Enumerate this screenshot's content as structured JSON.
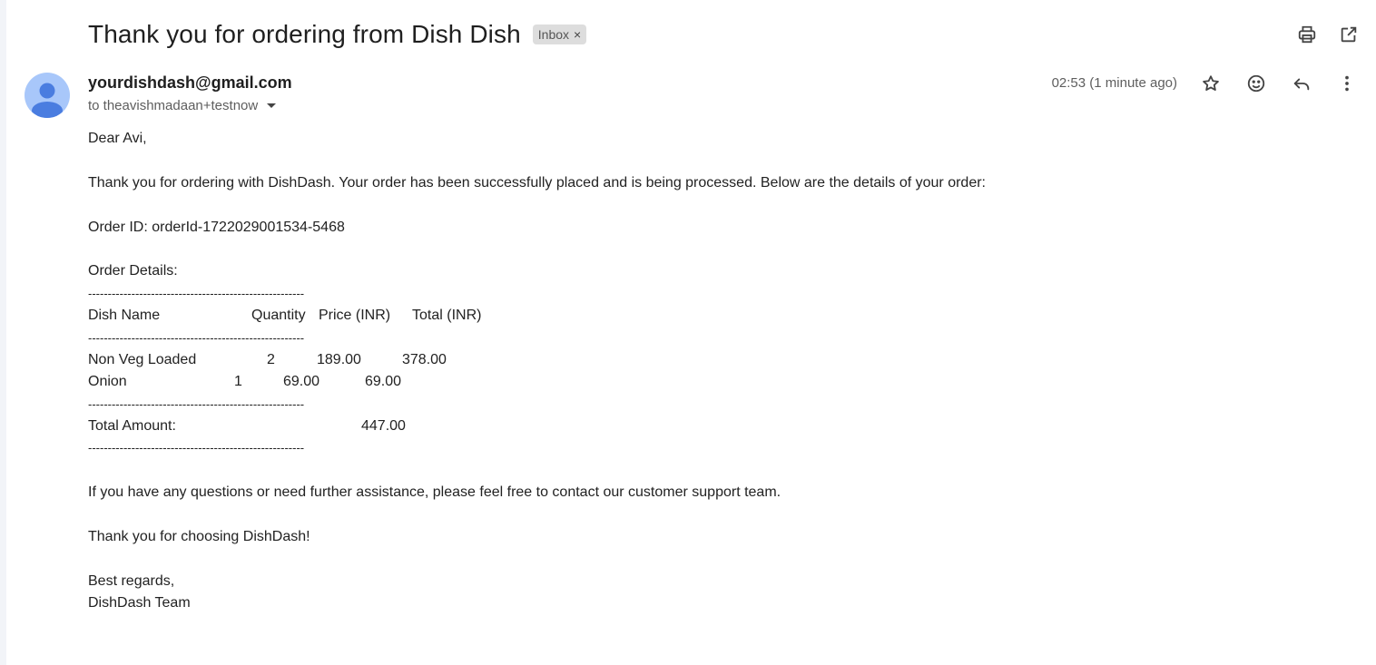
{
  "email": {
    "subject": "Thank you for ordering from Dish Dish",
    "label": "Inbox",
    "label_remove": "×",
    "sender": "yourdishdash@gmail.com",
    "recipient": "to theavishmadaan+testnow",
    "timestamp": "02:53 (1 minute ago)"
  },
  "icons": {
    "print": "print-icon",
    "open_new_window": "open-in-new-window-icon",
    "star": "star-icon",
    "emoji": "emoji-reaction-icon",
    "reply": "reply-icon",
    "more": "more-vert-icon",
    "avatar": "default-avatar-icon"
  },
  "body": {
    "greeting": "Dear Avi,",
    "intro": "Thank you for ordering with DishDash. Your order has been successfully placed and is being processed. Below are the details of your order:",
    "order_id": "Order ID: orderId-1722029001534-5468",
    "details_heading": "Order Details:",
    "separator": "-------------------------------------------------------",
    "table_headers": [
      "Dish Name",
      "Quantity",
      "Price (INR)",
      "Total (INR)"
    ],
    "items": [
      {
        "name": "Non Veg Loaded",
        "quantity": "2",
        "price": "189.00",
        "total": "378.00"
      },
      {
        "name": "Onion",
        "quantity": "1",
        "price": "69.00",
        "total": "69.00"
      }
    ],
    "total_label": "Total Amount:",
    "total_value": "447.00",
    "support": "If you have any questions or need further assistance, please feel free to contact our customer support team.",
    "thanks": "Thank you for choosing DishDash!",
    "signoff": "Best regards,",
    "signature": "DishDash Team"
  },
  "colors": {
    "avatar_bg": "#a8c7fa",
    "avatar_fg": "#4a7de0",
    "label_chip": "#dddddd"
  }
}
